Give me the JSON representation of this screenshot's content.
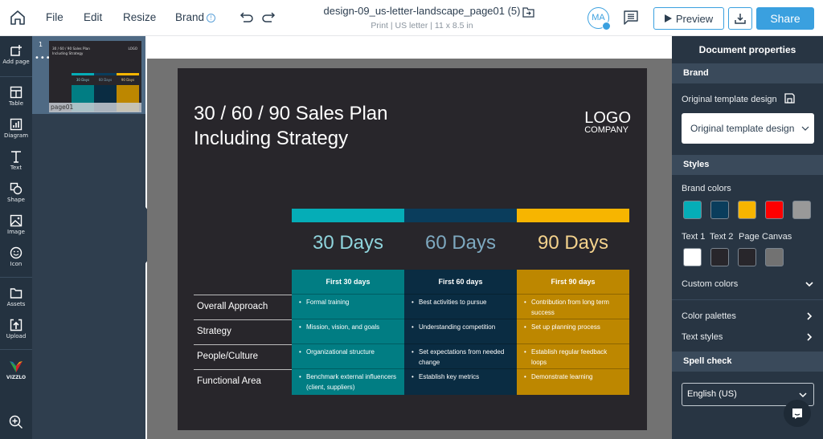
{
  "topbar": {
    "menu": [
      "File",
      "Edit",
      "Resize",
      "Brand"
    ],
    "doc_title": "design-09_us-letter-landscape_page01 (5)",
    "doc_subtitle": "Print | US letter | 11 x 8.5 in",
    "avatar_initials": "MA",
    "preview_label": "Preview",
    "share_label": "Share"
  },
  "leftnav": {
    "items": [
      {
        "label": "Add page",
        "icon": "add-page-icon"
      },
      {
        "label": "Table",
        "icon": "table-icon"
      },
      {
        "label": "Diagram",
        "icon": "diagram-icon"
      },
      {
        "label": "Text",
        "icon": "text-icon"
      },
      {
        "label": "Shape",
        "icon": "shape-icon"
      },
      {
        "label": "Image",
        "icon": "image-icon"
      },
      {
        "label": "Icon",
        "icon": "smiley-icon"
      },
      {
        "label": "Assets",
        "icon": "folder-icon"
      },
      {
        "label": "Upload",
        "icon": "upload-icon"
      }
    ],
    "brand": "VIZZLO"
  },
  "pages": {
    "number": "1",
    "label": "page01"
  },
  "slide": {
    "title_line1": "30 / 60 / 90 Sales Plan",
    "title_line2": "Including Strategy",
    "logo": "LOGO",
    "logo_sub": "COMPANY",
    "row_labels": [
      "Overall Approach",
      "Strategy",
      "People/Culture",
      "Functional Area"
    ],
    "columns": [
      {
        "days": "30 Days",
        "header": "First 30 days",
        "bar_color": "#05adb7",
        "days_color": "#8fd4dc",
        "body_color": "#017d83",
        "cells": [
          "Formal training",
          "Mission, vision, and goals",
          "Organizational structure",
          "Benchmark external influencers (client, suppliers)"
        ]
      },
      {
        "days": "60 Days",
        "header": "First 60 days",
        "bar_color": "#0a3d5c",
        "days_color": "#7ea9c0",
        "body_color": "#0a2c42",
        "cells": [
          "Best activities to pursue",
          "Understanding competition",
          "Set expectations from needed change",
          "Establish key metrics"
        ]
      },
      {
        "days": "90 Days",
        "header": "First 90 days",
        "bar_color": "#f7b500",
        "days_color": "#f4d28c",
        "body_color": "#bd8700",
        "cells": [
          "Contribution from long term success",
          "Set up planning process",
          "Establish regular feedback loops",
          "Demonstrate learning"
        ]
      }
    ]
  },
  "rpanel": {
    "title": "Document properties",
    "brand_section": "Brand",
    "template_label": "Original template design",
    "template_select": "Original template design",
    "styles_section": "Styles",
    "brand_colors_label": "Brand colors",
    "brand_colors": [
      "#05adb7",
      "#0a3d5c",
      "#f7b500",
      "#ff0000",
      "#999999"
    ],
    "text_labels": [
      "Text 1",
      "Text 2",
      "Page",
      "Canvas"
    ],
    "text_colors": [
      "#ffffff",
      "#28262b",
      "#28262b",
      "#727272"
    ],
    "custom_colors": "Custom colors",
    "color_palettes": "Color palettes",
    "text_styles": "Text styles",
    "spell_section": "Spell check",
    "spell_value": "English (US)"
  }
}
